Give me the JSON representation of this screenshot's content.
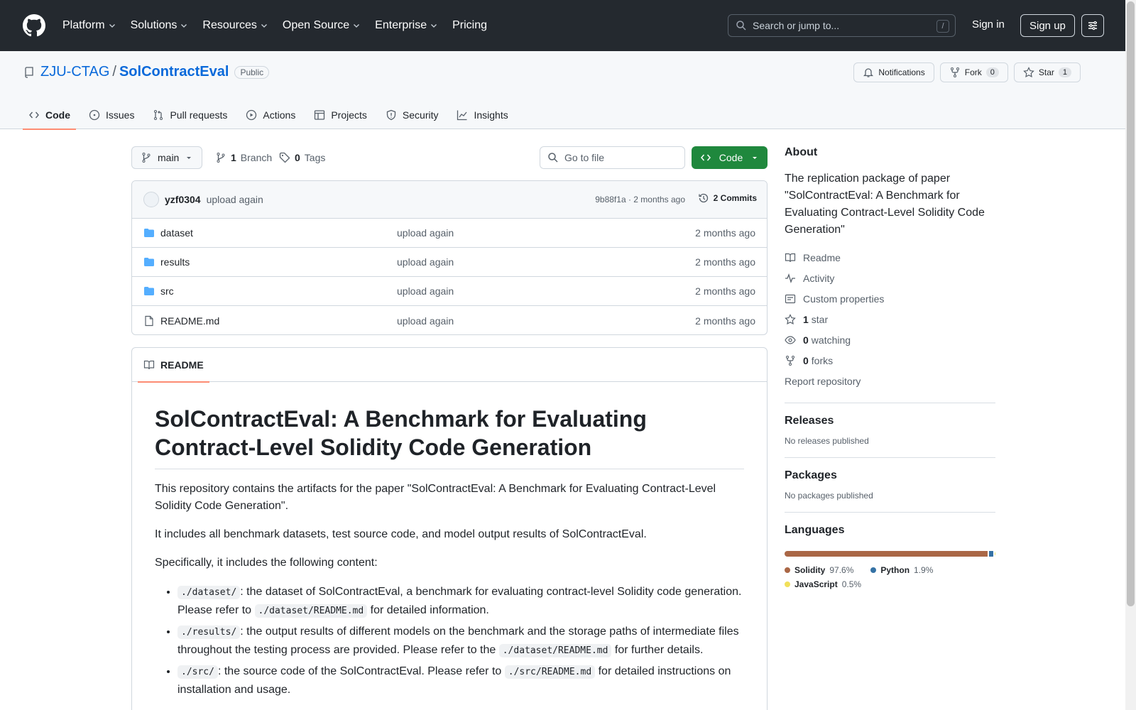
{
  "header": {
    "nav": [
      "Platform",
      "Solutions",
      "Resources",
      "Open Source",
      "Enterprise",
      "Pricing"
    ],
    "search_placeholder": "Search or jump to...",
    "search_shortcut": "/",
    "signin": "Sign in",
    "signup": "Sign up"
  },
  "repo": {
    "owner": "ZJU-CTAG",
    "separator": "/",
    "name": "SolContractEval",
    "visibility": "Public",
    "notifications_label": "Notifications",
    "fork_label": "Fork",
    "fork_count": "0",
    "star_label": "Star",
    "star_count": "1"
  },
  "tabs": [
    "Code",
    "Issues",
    "Pull requests",
    "Actions",
    "Projects",
    "Security",
    "Insights"
  ],
  "toolbar": {
    "branch": "main",
    "branch_count": "1",
    "branch_label": "Branch",
    "tag_count": "0",
    "tag_label": "Tags",
    "goto_placeholder": "Go to file",
    "code_label": "Code"
  },
  "latest_commit": {
    "user": "yzf0304",
    "message": "upload again",
    "meta": "9b88f1a · 2 months ago",
    "commits": "2 Commits"
  },
  "files": [
    {
      "name": "dataset",
      "type": "folder",
      "message": "upload again",
      "time": "2 months ago"
    },
    {
      "name": "results",
      "type": "folder",
      "message": "upload again",
      "time": "2 months ago"
    },
    {
      "name": "src",
      "type": "folder",
      "message": "upload again",
      "time": "2 months ago"
    },
    {
      "name": "README.md",
      "type": "file",
      "message": "upload again",
      "time": "2 months ago"
    }
  ],
  "readme": {
    "tab_label": "README",
    "title": "SolContractEval: A Benchmark for Evaluating Contract-Level Solidity Code Generation",
    "p1": "This repository contains the artifacts for the paper \"SolContractEval: A Benchmark for Evaluating Contract-Level Solidity Code Generation\".",
    "p2": "It includes all benchmark datasets, test source code, and model output results of SolContractEval.",
    "p3": "Specifically, it includes the following content:",
    "items": [
      {
        "code1": "./dataset/",
        "text1": ": the dataset of SolContractEval, a benchmark for evaluating contract-level Solidity code generation. Please refer to ",
        "code2": "./dataset/README.md",
        "text2": " for detailed information."
      },
      {
        "code1": "./results/",
        "text1": ": the output results of different models on the benchmark and the storage paths of intermediate files throughout the testing process are provided. Please refer to the ",
        "code2": "./dataset/README.md",
        "text2": " for further details."
      },
      {
        "code1": "./src/",
        "text1": ": the source code of the SolContractEval. Please refer to ",
        "code2": "./src/README.md",
        "text2": " for detailed instructions on installation and usage."
      }
    ]
  },
  "about": {
    "heading": "About",
    "description": "The replication package of paper \"SolContractEval: A Benchmark for Evaluating Contract-Level Solidity Code Generation\"",
    "readme": "Readme",
    "activity": "Activity",
    "custom_properties": "Custom properties",
    "stars_count": "1",
    "stars_label": "star",
    "watching_count": "0",
    "watching_label": "watching",
    "forks_count": "0",
    "forks_label": "forks",
    "report": "Report repository"
  },
  "releases": {
    "heading": "Releases",
    "note": "No releases published"
  },
  "packages": {
    "heading": "Packages",
    "note": "No packages published"
  },
  "languages": {
    "heading": "Languages",
    "items": [
      {
        "name": "Solidity",
        "percent": "97.6%",
        "value": 97.6,
        "color": "#AA6746"
      },
      {
        "name": "Python",
        "percent": "1.9%",
        "value": 1.9,
        "color": "#3572A5"
      },
      {
        "name": "JavaScript",
        "percent": "0.5%",
        "value": 0.5,
        "color": "#f1e05a"
      }
    ]
  }
}
